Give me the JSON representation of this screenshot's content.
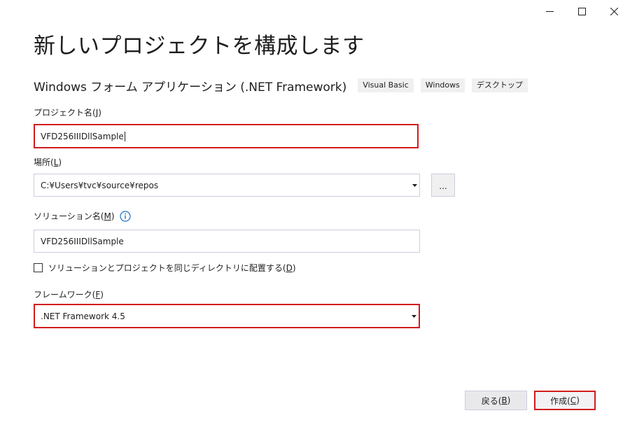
{
  "window": {
    "minimize_icon": "minimize-icon",
    "maximize_icon": "maximize-icon",
    "close_icon": "close-icon"
  },
  "page": {
    "title": "新しいプロジェクトを構成します"
  },
  "template": {
    "name": "Windows フォーム アプリケーション (.NET Framework)",
    "tags": [
      "Visual Basic",
      "Windows",
      "デスクトップ"
    ]
  },
  "project_name": {
    "label": "プロジェクト名(",
    "accel": "J",
    "label_end": ")",
    "value": "VFD256IIIDllSample"
  },
  "location": {
    "label": "場所(",
    "accel": "L",
    "label_end": ")",
    "value": "C:¥Users¥tvc¥source¥repos",
    "browse_label": "..."
  },
  "solution_name": {
    "label": "ソリューション名(",
    "accel": "M",
    "label_end": ")",
    "value": "VFD256IIIDllSample",
    "info_icon": "info-icon"
  },
  "same_dir": {
    "label": "ソリューションとプロジェクトを同じディレクトリに配置する(",
    "accel": "D",
    "label_end": ")",
    "checked": false
  },
  "framework": {
    "label": "フレームワーク(",
    "accel": "F",
    "label_end": ")",
    "value": ".NET Framework 4.5"
  },
  "buttons": {
    "back_label": "戻る(",
    "back_accel": "B",
    "back_end": ")",
    "create_label": "作成(",
    "create_accel": "C",
    "create_end": ")"
  },
  "colors": {
    "highlight": "#d11c1c",
    "info": "#1e73c8"
  }
}
